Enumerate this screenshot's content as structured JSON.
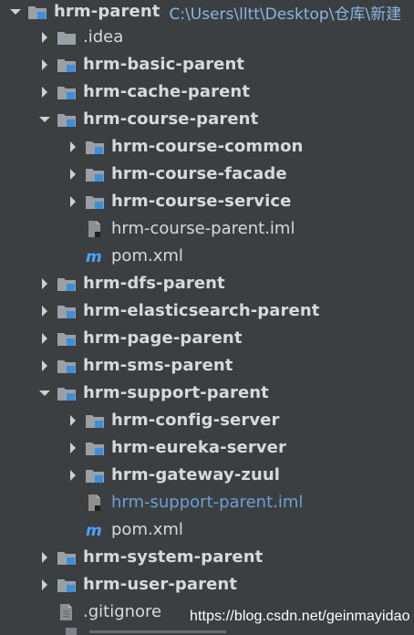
{
  "project": {
    "root_label": "hrm-parent",
    "root_path": "C:\\Users\\lltt\\Desktop\\仓库\\新建"
  },
  "rows": [
    {
      "label": ".idea",
      "kind": "folder"
    },
    {
      "label": "hrm-basic-parent",
      "kind": "module"
    },
    {
      "label": "hrm-cache-parent",
      "kind": "module"
    },
    {
      "label": "hrm-course-parent",
      "kind": "module",
      "expanded": true
    },
    {
      "label": "hrm-course-common",
      "kind": "module"
    },
    {
      "label": "hrm-course-facade",
      "kind": "module"
    },
    {
      "label": "hrm-course-service",
      "kind": "module"
    },
    {
      "label": "hrm-course-parent.iml",
      "kind": "iml-file"
    },
    {
      "label": "pom.xml",
      "kind": "maven-file"
    },
    {
      "label": "hrm-dfs-parent",
      "kind": "module"
    },
    {
      "label": "hrm-elasticsearch-parent",
      "kind": "module"
    },
    {
      "label": "hrm-page-parent",
      "kind": "module"
    },
    {
      "label": "hrm-sms-parent",
      "kind": "module"
    },
    {
      "label": "hrm-support-parent",
      "kind": "module",
      "expanded": true
    },
    {
      "label": "hrm-config-server",
      "kind": "module"
    },
    {
      "label": "hrm-eureka-server",
      "kind": "module"
    },
    {
      "label": "hrm-gateway-zuul",
      "kind": "module"
    },
    {
      "label": "hrm-support-parent.iml",
      "kind": "iml-file"
    },
    {
      "label": "pom.xml",
      "kind": "maven-file"
    },
    {
      "label": "hrm-system-parent",
      "kind": "module"
    },
    {
      "label": "hrm-user-parent",
      "kind": "module"
    },
    {
      "label": ".gitignore",
      "kind": "text-file"
    }
  ],
  "watermark": {
    "text": "https://blog.csdn.net/geinmayidao"
  },
  "icons": {
    "toggle_collapsed": "chevron-right-icon",
    "toggle_expanded": "chevron-down-icon",
    "folder": "folder-icon",
    "module": "module-folder-icon",
    "iml_file": "iml-file-icon",
    "maven_file": "maven-file-icon",
    "text_file": "text-file-icon"
  },
  "colors": {
    "background": "#3c3f41",
    "text": "#d9d9d9",
    "path": "#89b7e7",
    "blue_file": "#6d9fd8",
    "module_badge": "#3c8fd8",
    "maven": "#4aa3ff",
    "folder": "#9aa0a6"
  }
}
